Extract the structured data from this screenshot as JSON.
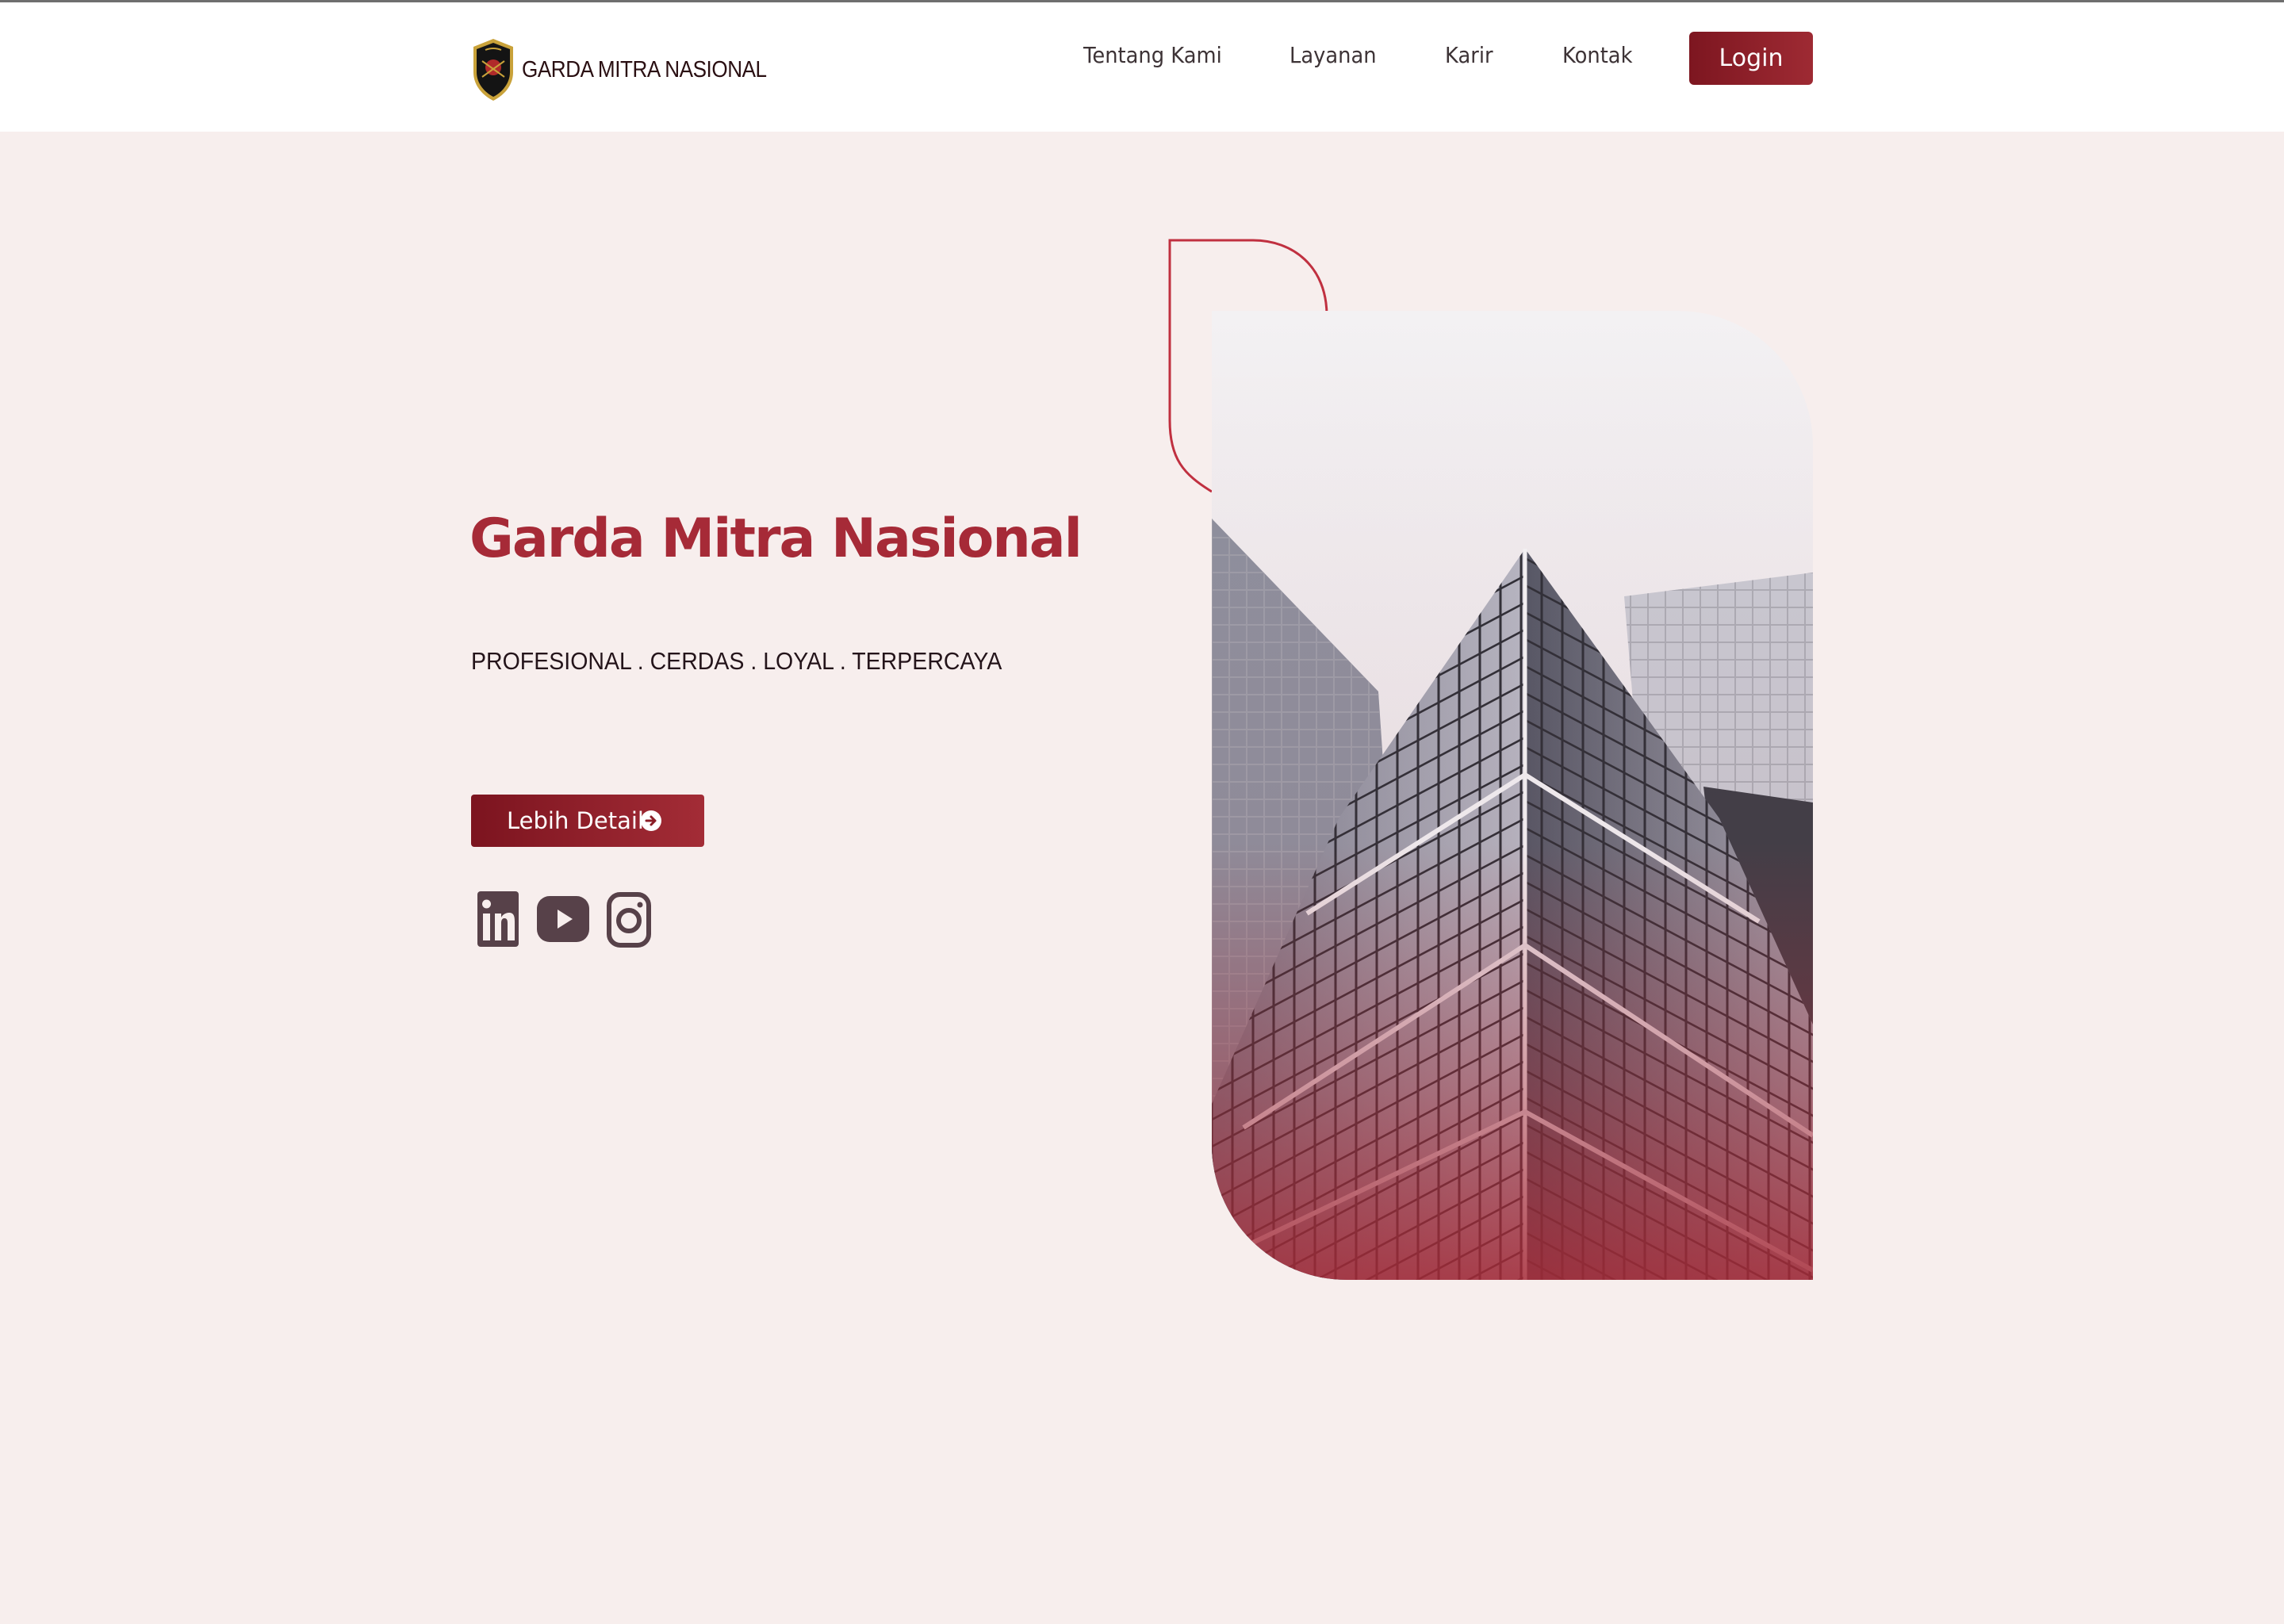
{
  "header": {
    "logo_text": "GARDA MITRA NASIONAL",
    "nav": [
      "Tentang Kami",
      "Layanan",
      "Karir",
      "Kontak"
    ],
    "login_label": "Login"
  },
  "hero": {
    "title": "Garda Mitra Nasional",
    "tagline": "PROFESIONAL . CERDAS . LOYAL . TERPERCAYA",
    "detail_button": "Lebih Detail"
  },
  "social": [
    "linkedin-icon",
    "youtube-icon",
    "instagram-icon"
  ],
  "colors": {
    "accent": "#a62a37",
    "button": "#8b1d27",
    "background": "#f7eeed",
    "icon": "#574149"
  }
}
